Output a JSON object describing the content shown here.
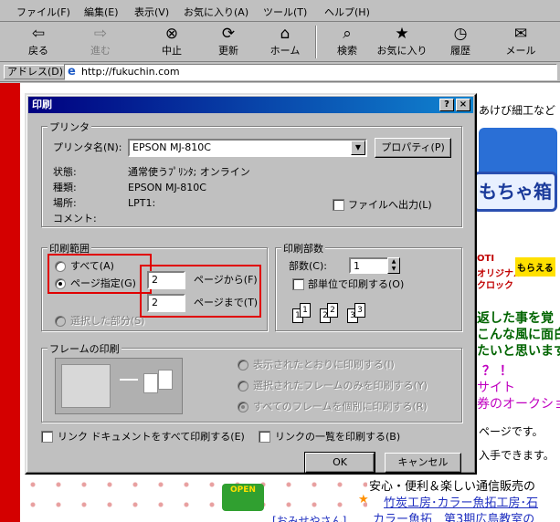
{
  "menu": [
    "ファイル(F)",
    "編集(E)",
    "表示(V)",
    "お気に入り(A)",
    "ツール(T)",
    "ヘルプ(H)"
  ],
  "toolbar": {
    "back": "戻る",
    "forward": "進む",
    "stop": "中止",
    "refresh": "更新",
    "home": "ホーム",
    "search": "検索",
    "favorites": "お気に入り",
    "history": "履歴",
    "mail": "メール"
  },
  "address": {
    "label": "アドレス(D)",
    "url": "http://fukuchin.com"
  },
  "webpage": {
    "top_text": "あけび細工など",
    "banner_text": "もちゃ箱",
    "ad_line1": "OTI",
    "ad_line2": "オリジナル",
    "ad_line3": "クロック",
    "ad_badge": "もらえる",
    "line1": "返した事を覚",
    "line2": "こんな風に面白",
    "line3": "たいと思います",
    "line4": "？ ！",
    "line5": "サイト",
    "line6": "券のオークショ",
    "line7": "ページです。",
    "line8": "入手できます。",
    "bottom1": "安心・便利＆楽しい通信販売の",
    "bottom2": "竹炭工房･カラー魚拓工房･石",
    "bottom3": "カラー魚拓　第3期広島教室の",
    "bottom4": "[おみせやさん]",
    "open_sign": "OPEN"
  },
  "dialog": {
    "title": "印刷",
    "help_btn": "?",
    "close_btn": "×",
    "printer": {
      "group": "プリンタ",
      "name_label": "プリンタ名(N):",
      "name_value": "EPSON MJ-810C",
      "properties": "プロパティ(P)",
      "status_label": "状態:",
      "status_value": "通常使うﾌﾟﾘﾝﾀ; オンライン",
      "type_label": "種類:",
      "type_value": "EPSON MJ-810C",
      "where_label": "場所:",
      "where_value": "LPT1:",
      "comment_label": "コメント:",
      "print_to_file": "ファイルへ出力(L)"
    },
    "range": {
      "group": "印刷範囲",
      "all": "すべて(A)",
      "pages": "ページ指定(G)",
      "selection": "選択した部分(S)",
      "from_value": "2",
      "from_label": "ページから(F)",
      "to_value": "2",
      "to_label": "ページまで(T)"
    },
    "copies": {
      "group": "印刷部数",
      "count_label": "部数(C):",
      "count_value": "1",
      "collate": "部単位で印刷する(O)",
      "collate_pages": [
        "1",
        "1",
        "2",
        "2",
        "3",
        "3"
      ]
    },
    "frames": {
      "group": "フレームの印刷",
      "as_laid_out": "表示されたとおりに印刷する(I)",
      "selected_frame": "選択されたフレームのみを印刷する(Y)",
      "each_frame": "すべてのフレームを個別に印刷する(R)"
    },
    "print_links": "リンク ドキュメントをすべて印刷する(E)",
    "print_link_table": "リンクの一覧を印刷する(B)",
    "ok": "OK",
    "cancel": "キャンセル"
  },
  "colors": {
    "title_start": "#000080",
    "highlight": "#e00000",
    "strip": "#d40000"
  }
}
